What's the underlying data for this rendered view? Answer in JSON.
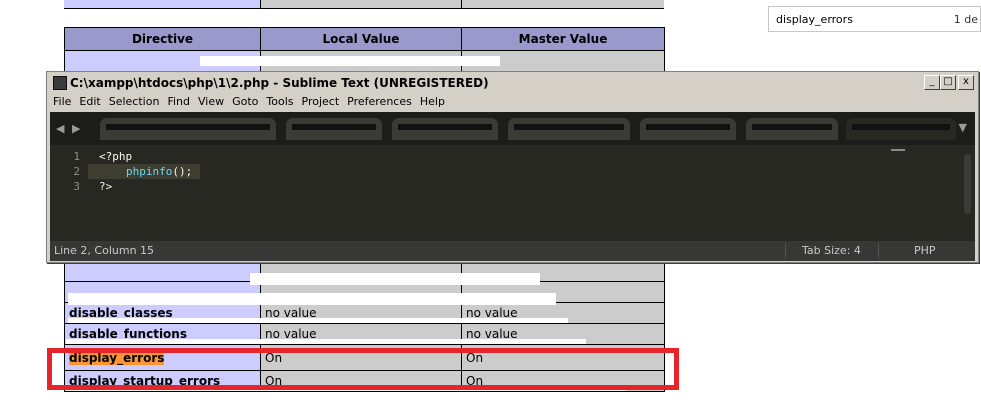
{
  "search": {
    "value": "display_errors",
    "count": "1 de"
  },
  "table": {
    "headers": [
      "Directive",
      "Local Value",
      "Master Value"
    ],
    "rows": {
      "disable_classes": [
        "disable_classes",
        "no value",
        "no value"
      ],
      "disable_functions": [
        "disable_functions",
        "no value",
        "no value"
      ],
      "display_errors": [
        "display_errors",
        "On",
        "On"
      ],
      "display_startup_errors": [
        "display_startup_errors",
        "On",
        "On"
      ]
    }
  },
  "window": {
    "title": "C:\\xampp\\htdocs\\php\\1\\2.php - Sublime Text (UNREGISTERED)",
    "controls": {
      "minimize": "_",
      "maximize": "□",
      "close": "x"
    },
    "menu": [
      "File",
      "Edit",
      "Selection",
      "Find",
      "View",
      "Goto",
      "Tools",
      "Project",
      "Preferences",
      "Help"
    ]
  },
  "editor": {
    "line_numbers": [
      "1",
      "2",
      "3"
    ],
    "lines": {
      "l1": "<?php",
      "l2_fn": "phpinfo",
      "l2_rest": "();",
      "l3": "?>"
    }
  },
  "status": {
    "position": "Line 2, Column 15",
    "tab_size": "Tab Size: 4",
    "syntax": "PHP"
  },
  "colors": {
    "header": "#9999cc",
    "directive": "#ccccff",
    "value": "#cccccc",
    "highlight": "#ff9632",
    "annotation": "#e8242b",
    "editor_bg": "#272822"
  }
}
